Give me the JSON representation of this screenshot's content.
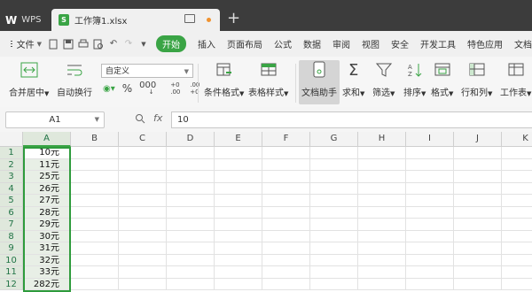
{
  "titlebar": {
    "app_label": "WPS",
    "file_tab": "工作簿1.xlsx",
    "new_tab": "+"
  },
  "menubar": {
    "file_menu": "文件",
    "start_tab": "开始",
    "items": [
      "插入",
      "页面布局",
      "公式",
      "数据",
      "审阅",
      "视图",
      "安全",
      "开发工具",
      "特色应用",
      "文档"
    ]
  },
  "ribbon": {
    "merge_center": "合并居中",
    "wrap_text": "自动换行",
    "number_format": "自定义",
    "percent": "%",
    "thousands": "000",
    "inc_decimal": "+0 .00",
    "dec_decimal": ".00 +0",
    "conditional_format": "条件格式",
    "table_style": "表格样式",
    "doc_helper": "文档助手",
    "sum": "求和",
    "filter": "筛选",
    "sort": "排序",
    "format": "格式",
    "row_col": "行和列",
    "worksheet": "工作表"
  },
  "formula_bar": {
    "cell_ref": "A1",
    "fx": "fx",
    "value": "10"
  },
  "sheet": {
    "columns": [
      "A",
      "B",
      "C",
      "D",
      "E",
      "F",
      "G",
      "H",
      "I",
      "J",
      "K"
    ],
    "selected_column": "A",
    "rows": [
      {
        "num": "1",
        "a": "10元"
      },
      {
        "num": "2",
        "a": "11元"
      },
      {
        "num": "3",
        "a": "25元"
      },
      {
        "num": "4",
        "a": "26元"
      },
      {
        "num": "5",
        "a": "27元"
      },
      {
        "num": "6",
        "a": "28元"
      },
      {
        "num": "7",
        "a": "29元"
      },
      {
        "num": "8",
        "a": "30元"
      },
      {
        "num": "9",
        "a": "31元"
      },
      {
        "num": "10",
        "a": "32元"
      },
      {
        "num": "11",
        "a": "33元"
      },
      {
        "num": "12",
        "a": "282元"
      }
    ]
  },
  "colors": {
    "accent": "#3aa445",
    "titlebar_bg": "#3c3c3c",
    "selection_fill": "#e8efe6"
  }
}
